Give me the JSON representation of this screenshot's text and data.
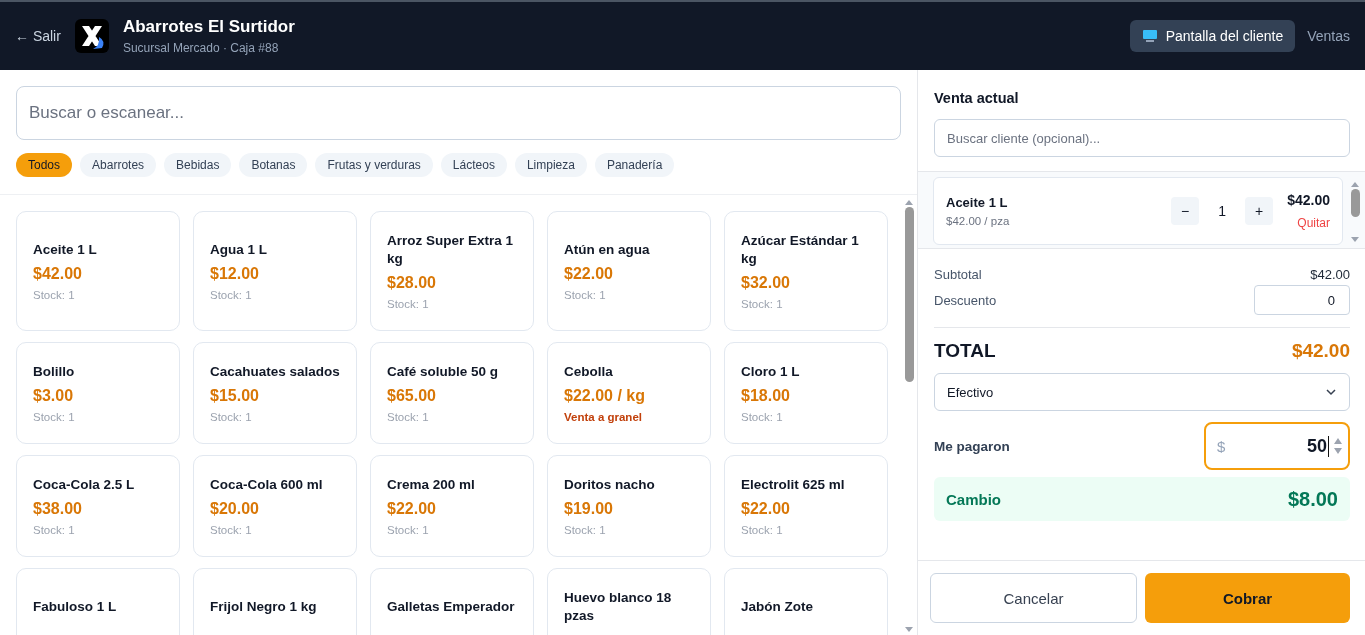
{
  "header": {
    "back_link": "← Salir",
    "store_name": "Abarrotes El Surtidor",
    "branch": "Sucursal Mercado · Caja #88",
    "customer_screen_button": "Pantalla del cliente",
    "sales_link": "Ventas"
  },
  "search": {
    "placeholder": "Buscar o escanear..."
  },
  "categories": [
    {
      "label": "Todos",
      "selected": true
    },
    {
      "label": "Abarrotes",
      "selected": false
    },
    {
      "label": "Bebidas",
      "selected": false
    },
    {
      "label": "Botanas",
      "selected": false
    },
    {
      "label": "Frutas y verduras",
      "selected": false
    },
    {
      "label": "Lácteos",
      "selected": false
    },
    {
      "label": "Limpieza",
      "selected": false
    },
    {
      "label": "Panadería",
      "selected": false
    }
  ],
  "products": [
    {
      "name": "Aceite 1 L",
      "price": "$42.00",
      "stock": "Stock: 1"
    },
    {
      "name": "Agua 1 L",
      "price": "$12.00",
      "stock": "Stock: 1"
    },
    {
      "name": "Arroz Super Extra 1 kg",
      "price": "$28.00",
      "stock": "Stock: 1"
    },
    {
      "name": "Atún en agua",
      "price": "$22.00",
      "stock": "Stock: 1"
    },
    {
      "name": "Azúcar Estándar 1 kg",
      "price": "$32.00",
      "stock": "Stock: 1"
    },
    {
      "name": "Bolillo",
      "price": "$3.00",
      "stock": "Stock: 1"
    },
    {
      "name": "Cacahuates salados",
      "price": "$15.00",
      "stock": "Stock: 1"
    },
    {
      "name": "Café soluble 50 g",
      "price": "$65.00",
      "stock": "Stock: 1"
    },
    {
      "name": "Cebolla",
      "price": "$22.00 / kg",
      "note": "Venta a granel"
    },
    {
      "name": "Cloro 1 L",
      "price": "$18.00",
      "stock": "Stock: 1"
    },
    {
      "name": "Coca-Cola 2.5 L",
      "price": "$38.00",
      "stock": "Stock: 1"
    },
    {
      "name": "Coca-Cola 600 ml",
      "price": "$20.00",
      "stock": "Stock: 1"
    },
    {
      "name": "Crema 200 ml",
      "price": "$22.00",
      "stock": "Stock: 1"
    },
    {
      "name": "Doritos nacho",
      "price": "$19.00",
      "stock": "Stock: 1"
    },
    {
      "name": "Electrolit 625 ml",
      "price": "$22.00",
      "stock": "Stock: 1"
    },
    {
      "name": "Fabuloso 1 L"
    },
    {
      "name": "Frijol Negro 1 kg"
    },
    {
      "name": "Galletas Emperador"
    },
    {
      "name": "Huevo blanco 18 pzas"
    },
    {
      "name": "Jabón Zote"
    }
  ],
  "sale": {
    "title": "Venta actual",
    "customer_search": {
      "placeholder": "Buscar cliente (opcional)..."
    },
    "items": [
      {
        "name": "Aceite 1 L",
        "unit_price": "$42.00 / pza",
        "decrement": "−",
        "quantity": "1",
        "increment": "+",
        "line_total": "$42.00",
        "remove": "Quitar"
      }
    ],
    "subtotal_label": "Subtotal",
    "subtotal": "$42.00",
    "discount_label": "Descuento",
    "discount": "0",
    "total_label": "TOTAL",
    "total": "$42.00",
    "payment_method": "Efectivo",
    "paid_label": "Me pagaron",
    "paid_currency": "$",
    "paid": "50",
    "change_label": "Cambio",
    "change": "$8.00",
    "cancel_button": "Cancelar",
    "charge_button": "Cobrar"
  }
}
